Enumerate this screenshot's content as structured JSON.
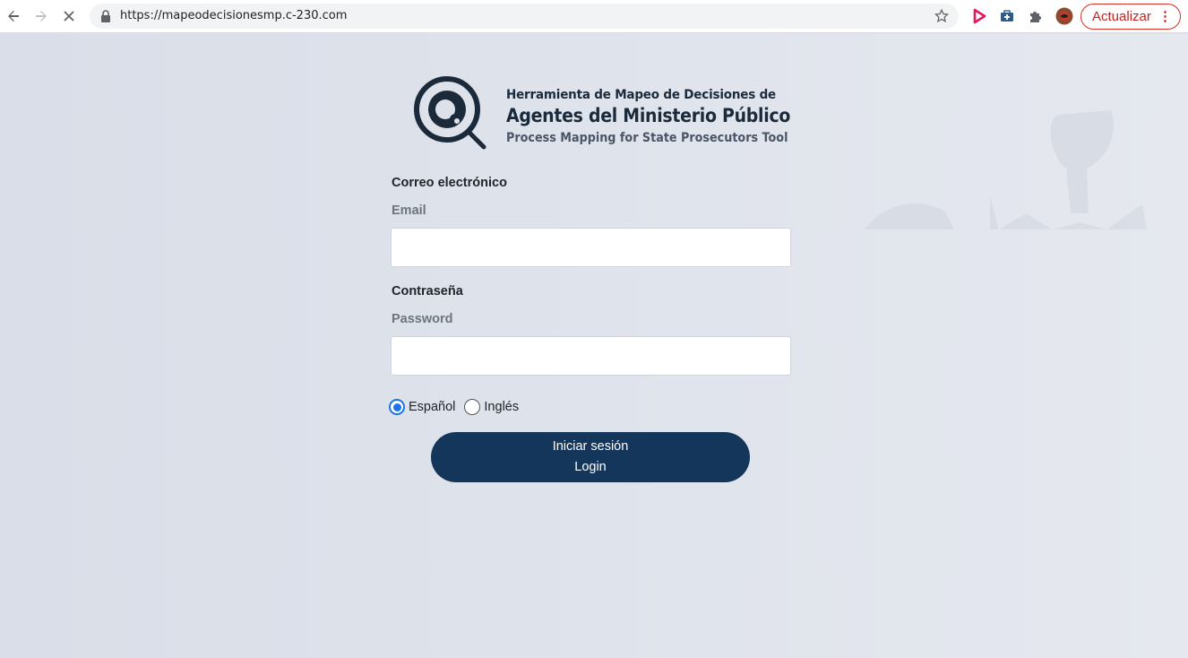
{
  "browser": {
    "url": "https://mapeodecisionesmp.c-230.com",
    "update_label": "Actualizar",
    "menu_glyph": "⋮"
  },
  "logo": {
    "line1": "Herramienta de Mapeo de Decisiones de",
    "line2": "Agentes del Ministerio Público",
    "line3": "Process Mapping for State Prosecutors Tool"
  },
  "form": {
    "email_label": "Correo electrónico",
    "email_label_en": "Email",
    "email_value": "",
    "password_label": "Contraseña",
    "password_label_en": "Password",
    "password_value": "",
    "languages": [
      {
        "label": "Español",
        "selected": true
      },
      {
        "label": "Inglés",
        "selected": false
      }
    ],
    "login_label": "Iniciar sesión",
    "login_label_en": "Login"
  },
  "colors": {
    "brand_navy": "#13365a",
    "update_red": "#c5221f",
    "radio_blue": "#1a73e8"
  }
}
